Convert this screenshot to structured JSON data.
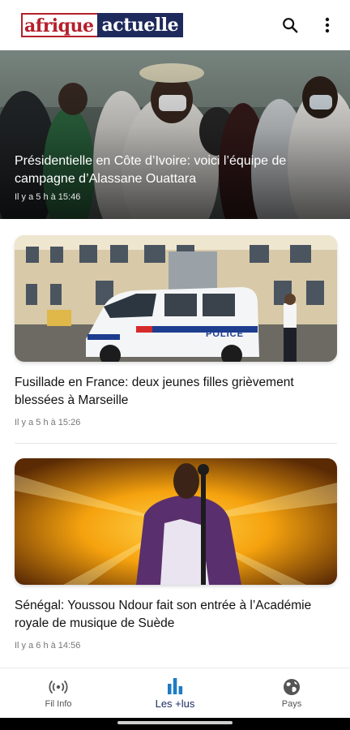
{
  "app": {
    "logo_part1": "afrique",
    "logo_part2": "actuelle",
    "search_icon": "search-icon",
    "menu_icon": "more-vert-icon"
  },
  "hero": {
    "title": "Présidentielle en Côte d’Ivoire: voici l’équipe de campagne d’Alassane Ouattara",
    "time": "Il y a 5 h à 15:46"
  },
  "articles": [
    {
      "title": "Fusillade en France: deux jeunes filles grièvement blessées à Marseille",
      "time": "Il y a 5 h à 15:26",
      "badge": "POLICE"
    },
    {
      "title": "Sénégal: Youssou Ndour fait son entrée à l’Académie royale de musique de Suède",
      "time": "Il y a 6 h à 14:56"
    }
  ],
  "nav": {
    "items": [
      {
        "label": "Fil Info",
        "icon": "broadcast-icon",
        "active": false
      },
      {
        "label": "Les +lus",
        "icon": "bar-chart-icon",
        "active": true
      },
      {
        "label": "Pays",
        "icon": "globe-icon",
        "active": false
      }
    ]
  },
  "colors": {
    "brand_red": "#b51f2b",
    "brand_navy": "#1f2a5c",
    "active_nav": "#1b2b63"
  }
}
